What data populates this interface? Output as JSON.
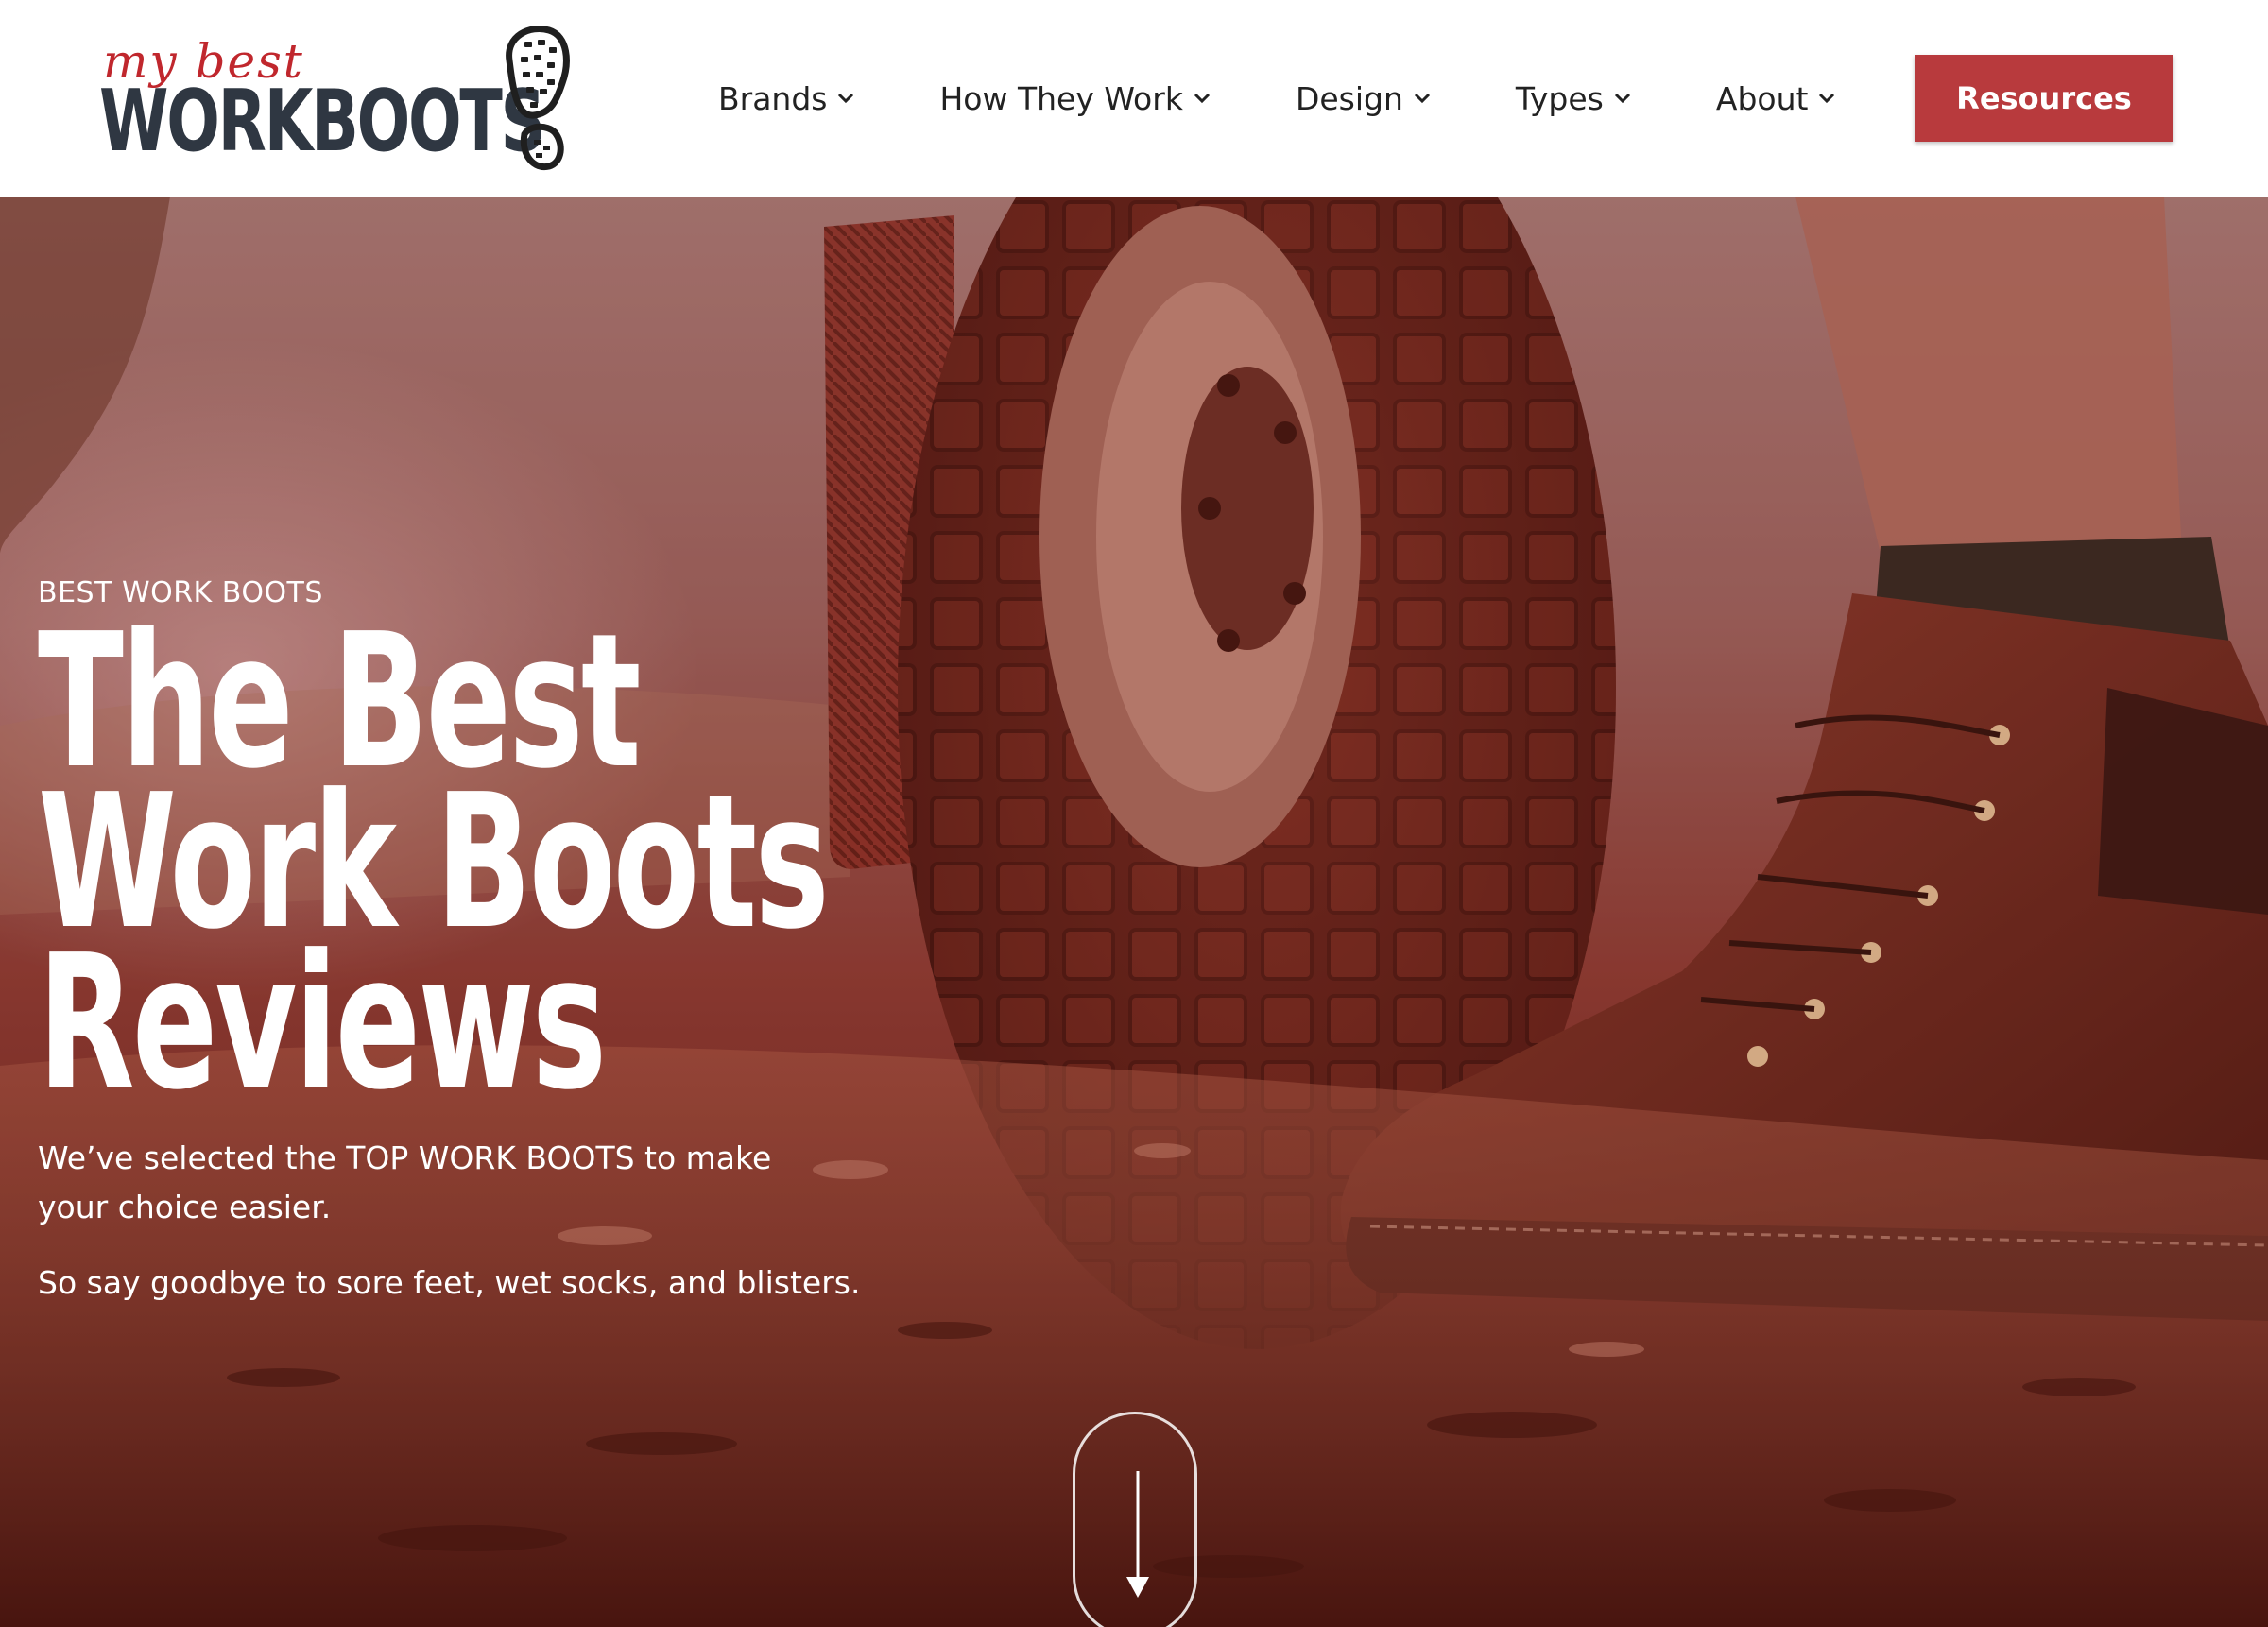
{
  "logo": {
    "script_text": "my best",
    "word_text": "WORKBOOTS",
    "icon": "boot-sole-icon"
  },
  "nav": {
    "items": [
      {
        "label": "Brands"
      },
      {
        "label": "How They Work"
      },
      {
        "label": "Design"
      },
      {
        "label": "Types"
      },
      {
        "label": "About"
      }
    ],
    "chevron_icon": "chevron-down-icon",
    "resources_label": "Resources"
  },
  "hero": {
    "eyebrow": "BEST WORK BOOTS",
    "title_lines": [
      "The Best",
      "Work Boots",
      "Reviews"
    ],
    "description": "We’ve selected the TOP WORK BOOTS to make your choice easier.",
    "description2": "So say goodbye to sore feet, wet socks, and blisters.",
    "scroll_icon": "arrow-down-icon"
  },
  "colors": {
    "accent": "#b83a3d",
    "logo_red": "#c0272d",
    "logo_dark": "#2f3742",
    "hero_tint": "#8a3c33"
  }
}
